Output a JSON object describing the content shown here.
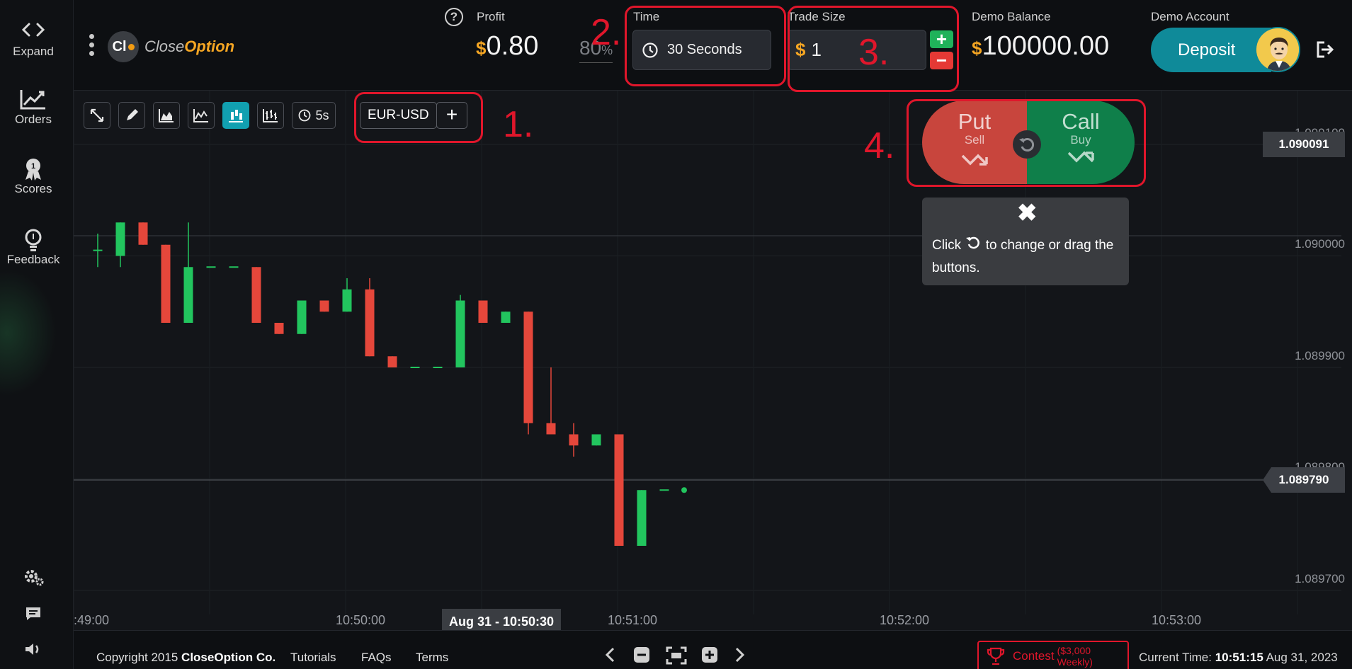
{
  "sidebar": {
    "items": [
      {
        "label": "Expand",
        "icon": "expand-icon"
      },
      {
        "label": "Orders",
        "icon": "chart-line-icon"
      },
      {
        "label": "Scores",
        "icon": "medal-icon"
      },
      {
        "label": "Feedback",
        "icon": "bulb-icon"
      }
    ],
    "bottom_icons": [
      "gear-icon",
      "chat-icon",
      "volume-icon"
    ]
  },
  "header": {
    "logo_prefix": "Cl",
    "logo_text_light": "Close",
    "logo_text_bold": "Option",
    "profit_label": "Profit",
    "currency_symbol": "$",
    "profit_value": "0.80",
    "payout_percent": "80",
    "payout_unit": "%",
    "time_label": "Time",
    "time_value": "30 Seconds",
    "trade_size_label": "Trade Size",
    "trade_size_value": "1",
    "plus_label": "+",
    "minus_label": "−",
    "balance_label": "Demo Balance",
    "balance_value": "100000.00",
    "account_label": "Demo Account",
    "deposit_label": "Deposit"
  },
  "toolbar": {
    "interval_label": "5s",
    "pair_label": "EUR-USD",
    "add_label": "+",
    "active_tool": "candles",
    "accent": "#11a0b0"
  },
  "trade": {
    "put_label": "Put",
    "put_sub": "Sell",
    "call_label": "Call",
    "call_sub": "Buy",
    "put_color": "#c8453d",
    "call_color": "#0f7f4a"
  },
  "tooltip": {
    "close_glyph": "✖",
    "text_before": "Click",
    "text_after": "to change or drag the buttons."
  },
  "annotations": [
    "1.",
    "2.",
    "3.",
    "4."
  ],
  "chart": {
    "price_labels": [
      "1.090100",
      "1.090000",
      "1.089900",
      "1.089800",
      "1.089700"
    ],
    "high_tag": "1.090091",
    "current_tag": "1.089790",
    "time_ticks": [
      ":49:00",
      "10:50:00",
      "10:51:00",
      "10:52:00",
      "10:53:00"
    ],
    "cursor_time": "Aug 31 - 10:50:30",
    "colors": {
      "up": "#22c55e",
      "down": "#e5473b"
    }
  },
  "chart_data": {
    "type": "candlestick",
    "x_unit": "5s",
    "ylim": [
      1.08965,
      1.09015
    ],
    "candles": [
      {
        "o": 1.090005,
        "c": 1.090005,
        "h": 1.09002,
        "l": 1.08999,
        "dir": "flat"
      },
      {
        "o": 1.09,
        "c": 1.09003,
        "h": 1.09003,
        "l": 1.08999,
        "dir": "up"
      },
      {
        "o": 1.09003,
        "c": 1.09001,
        "h": 1.09003,
        "l": 1.09001,
        "dir": "down"
      },
      {
        "o": 1.09001,
        "c": 1.08994,
        "h": 1.09001,
        "l": 1.08994,
        "dir": "down"
      },
      {
        "o": 1.08994,
        "c": 1.08999,
        "h": 1.09003,
        "l": 1.08994,
        "dir": "up"
      },
      {
        "o": 1.08999,
        "c": 1.08999,
        "h": 1.08999,
        "l": 1.08999,
        "dir": "flat"
      },
      {
        "o": 1.08999,
        "c": 1.08999,
        "h": 1.08999,
        "l": 1.08999,
        "dir": "flat"
      },
      {
        "o": 1.08999,
        "c": 1.08994,
        "h": 1.08999,
        "l": 1.08994,
        "dir": "down"
      },
      {
        "o": 1.08994,
        "c": 1.08993,
        "h": 1.08994,
        "l": 1.08993,
        "dir": "down"
      },
      {
        "o": 1.08993,
        "c": 1.08996,
        "h": 1.08996,
        "l": 1.08993,
        "dir": "up"
      },
      {
        "o": 1.08996,
        "c": 1.08995,
        "h": 1.08996,
        "l": 1.08995,
        "dir": "down"
      },
      {
        "o": 1.08995,
        "c": 1.08997,
        "h": 1.08998,
        "l": 1.08995,
        "dir": "up"
      },
      {
        "o": 1.08997,
        "c": 1.08991,
        "h": 1.08998,
        "l": 1.08991,
        "dir": "down"
      },
      {
        "o": 1.08991,
        "c": 1.0899,
        "h": 1.08991,
        "l": 1.0899,
        "dir": "down"
      },
      {
        "o": 1.0899,
        "c": 1.0899,
        "h": 1.0899,
        "l": 1.0899,
        "dir": "flat"
      },
      {
        "o": 1.0899,
        "c": 1.0899,
        "h": 1.0899,
        "l": 1.0899,
        "dir": "flat"
      },
      {
        "o": 1.0899,
        "c": 1.08996,
        "h": 1.089965,
        "l": 1.0899,
        "dir": "up"
      },
      {
        "o": 1.08996,
        "c": 1.08994,
        "h": 1.08996,
        "l": 1.08994,
        "dir": "down"
      },
      {
        "o": 1.08994,
        "c": 1.08995,
        "h": 1.08995,
        "l": 1.08994,
        "dir": "up"
      },
      {
        "o": 1.08995,
        "c": 1.08985,
        "h": 1.08995,
        "l": 1.08984,
        "dir": "down"
      },
      {
        "o": 1.08985,
        "c": 1.08984,
        "h": 1.0899,
        "l": 1.08984,
        "dir": "down"
      },
      {
        "o": 1.08984,
        "c": 1.08983,
        "h": 1.08985,
        "l": 1.08982,
        "dir": "down"
      },
      {
        "o": 1.08983,
        "c": 1.08984,
        "h": 1.08984,
        "l": 1.08983,
        "dir": "up"
      },
      {
        "o": 1.08984,
        "c": 1.08974,
        "h": 1.08984,
        "l": 1.08974,
        "dir": "down"
      },
      {
        "o": 1.08974,
        "c": 1.08979,
        "h": 1.08979,
        "l": 1.08974,
        "dir": "up"
      },
      {
        "o": 1.08979,
        "c": 1.08979,
        "h": 1.08979,
        "l": 1.08979,
        "dir": "flat"
      }
    ]
  },
  "footer": {
    "copyright_prefix": "Copyright 2015",
    "copyright_company": "CloseOption Co.",
    "links": [
      "Tutorials",
      "FAQs",
      "Terms"
    ],
    "contest_label": "Contest",
    "contest_sub": "($3,000 Weekly)",
    "current_time_label": "Current Time:",
    "current_time_value": "10:51:15",
    "current_date": "Aug 31, 2023"
  }
}
